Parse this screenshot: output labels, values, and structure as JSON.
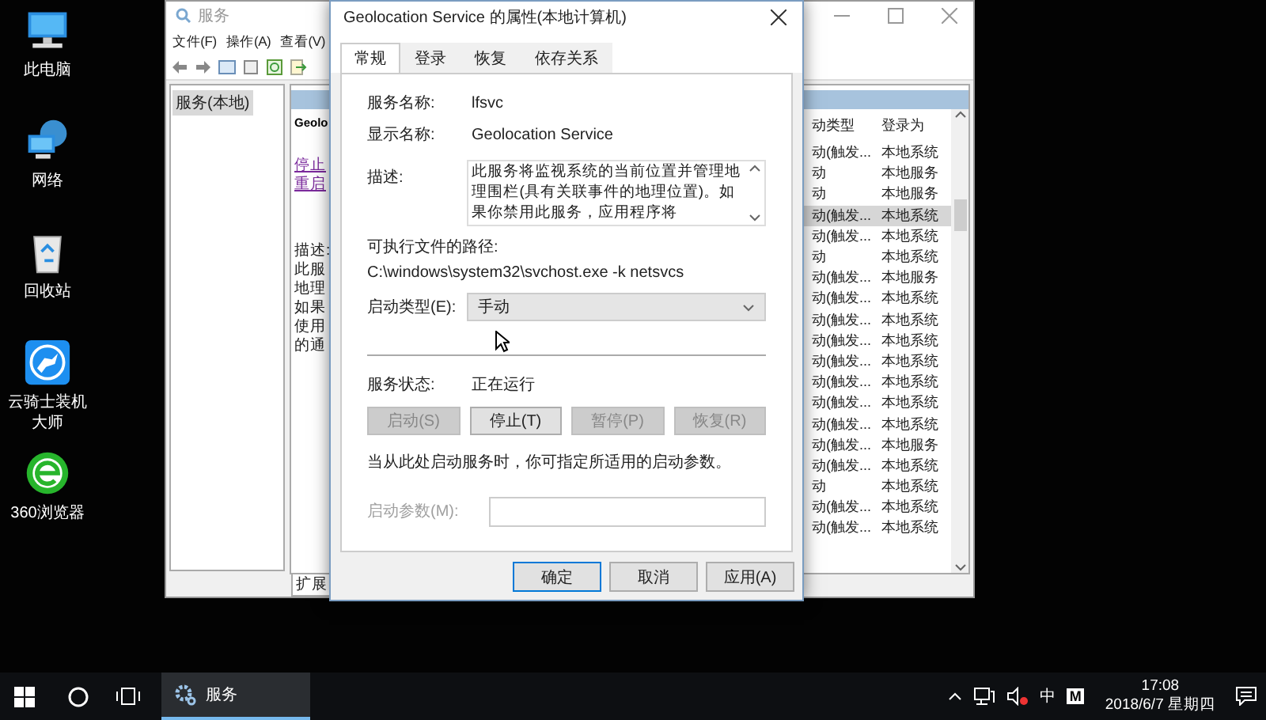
{
  "desktop_icons": [
    {
      "label": "此电脑",
      "kind": "computer"
    },
    {
      "label": "网络",
      "kind": "network"
    },
    {
      "label": "回收站",
      "kind": "recycle"
    },
    {
      "label": "云骑士装机大师",
      "kind": "knight"
    },
    {
      "label": "360浏览器",
      "kind": "browser"
    }
  ],
  "services_window": {
    "title": "服务",
    "menu": [
      "文件(F)",
      "操作(A)",
      "查看(V)"
    ],
    "tree": [
      {
        "label": "服务(本地)",
        "selected": true
      }
    ],
    "detail": {
      "title": "Geolo",
      "lines": [
        {
          "text": "停止",
          "kind": "link"
        },
        {
          "text": "重启",
          "kind": "link"
        },
        {
          "text": "描述:",
          "kind": "gap"
        },
        {
          "text": "此服",
          "kind": "text"
        },
        {
          "text": "地理",
          "kind": "text"
        },
        {
          "text": "如果",
          "kind": "text"
        },
        {
          "text": "使用",
          "kind": "text"
        },
        {
          "text": "的通",
          "kind": "text"
        }
      ]
    },
    "bottom_tabs": [
      {
        "label": "扩展",
        "selected": true
      }
    ],
    "columns": [
      "动类型",
      "登录为"
    ],
    "rows": [
      {
        "startup": "动(触发...",
        "logon": "本地系统",
        "selected": false
      },
      {
        "startup": "动",
        "logon": "本地服务",
        "selected": false
      },
      {
        "startup": "动",
        "logon": "本地服务",
        "selected": false
      },
      {
        "startup": "动(触发...",
        "logon": "本地系统",
        "selected": true
      },
      {
        "startup": "动(触发...",
        "logon": "本地系统",
        "selected": false
      },
      {
        "startup": "动",
        "logon": "本地系统",
        "selected": false
      },
      {
        "startup": "动(触发...",
        "logon": "本地服务",
        "selected": false
      },
      {
        "startup": "动(触发...",
        "logon": "本地系统",
        "selected": false
      },
      {
        "startup": "动(触发...",
        "logon": "本地系统",
        "selected": false
      },
      {
        "startup": "动(触发...",
        "logon": "本地系统",
        "selected": false
      },
      {
        "startup": "动(触发...",
        "logon": "本地系统",
        "selected": false
      },
      {
        "startup": "动(触发...",
        "logon": "本地系统",
        "selected": false
      },
      {
        "startup": "动(触发...",
        "logon": "本地系统",
        "selected": false
      },
      {
        "startup": "动(触发...",
        "logon": "本地系统",
        "selected": false
      },
      {
        "startup": "动(触发...",
        "logon": "本地服务",
        "selected": false
      },
      {
        "startup": "动(触发...",
        "logon": "本地系统",
        "selected": false
      },
      {
        "startup": "动",
        "logon": "本地系统",
        "selected": false
      },
      {
        "startup": "动(触发...",
        "logon": "本地系统",
        "selected": false
      },
      {
        "startup": "动(触发...",
        "logon": "本地系统",
        "selected": false
      }
    ]
  },
  "dialog": {
    "title": "Geolocation Service 的属性(本地计算机)",
    "tabs": [
      {
        "label": "常规",
        "selected": true
      },
      {
        "label": "登录",
        "selected": false
      },
      {
        "label": "恢复",
        "selected": false
      },
      {
        "label": "依存关系",
        "selected": false
      }
    ],
    "service_name_label": "服务名称:",
    "service_name": "lfsvc",
    "display_name_label": "显示名称:",
    "display_name": "Geolocation Service",
    "description_label": "描述:",
    "description": "此服务将监视系统的当前位置并管理地理围栏(具有关联事件的地理位置)。如果你禁用此服务，应用程序将",
    "path_label": "可执行文件的路径:",
    "path": "C:\\windows\\system32\\svchost.exe -k netsvcs",
    "startup_label": "启动类型(E):",
    "startup_value": "手动",
    "status_label": "服务状态:",
    "status": "正在运行",
    "control_buttons": [
      {
        "label": "启动(S)",
        "disabled": true
      },
      {
        "label": "停止(T)",
        "disabled": false
      },
      {
        "label": "暂停(P)",
        "disabled": true
      },
      {
        "label": "恢复(R)",
        "disabled": true
      }
    ],
    "hint": "当从此处启动服务时，你可指定所适用的启动参数。",
    "params_label": "启动参数(M):",
    "params_disabled": true,
    "buttons": [
      {
        "label": "确定",
        "default": true
      },
      {
        "label": "取消",
        "default": false
      },
      {
        "label": "应用(A)",
        "default": false
      }
    ]
  },
  "taskbar": {
    "app": "服务",
    "ime": "中",
    "m_label": "M",
    "time": "17:08",
    "date": "2018/6/7 星期四"
  }
}
